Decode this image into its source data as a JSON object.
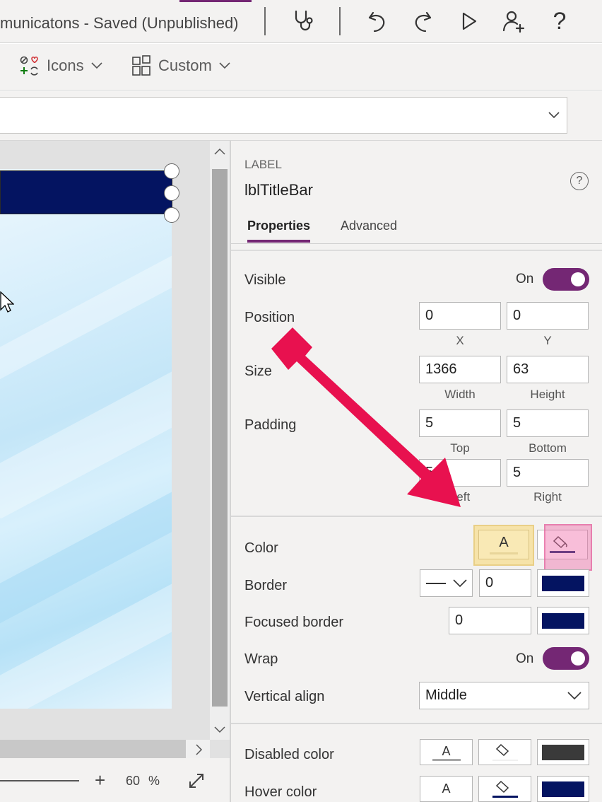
{
  "titlebar": {
    "title": "municatons - Saved (Unpublished)",
    "icons": [
      "stethoscope-icon",
      "undo-icon",
      "redo-icon",
      "play-icon",
      "add-user-icon",
      "help-icon"
    ]
  },
  "ribbon": {
    "icons_label": "Icons",
    "custom_label": "Custom"
  },
  "canvas": {
    "zoom_value": "60",
    "zoom_unit": "%"
  },
  "panel": {
    "control_type": "LABEL",
    "control_name": "lblTitleBar",
    "tabs": [
      {
        "label": "Properties",
        "active": true
      },
      {
        "label": "Advanced",
        "active": false
      }
    ],
    "visible": {
      "label": "Visible",
      "state": "On"
    },
    "position": {
      "label": "Position",
      "x": "0",
      "y": "0",
      "x_caption": "X",
      "y_caption": "Y"
    },
    "size": {
      "label": "Size",
      "width": "1366",
      "height": "63",
      "width_caption": "Width",
      "height_caption": "Height"
    },
    "padding": {
      "label": "Padding",
      "top": "5",
      "bottom": "5",
      "left": "5",
      "right": "5",
      "top_caption": "Top",
      "bottom_caption": "Bottom",
      "left_caption": "Left",
      "right_caption": "Right"
    },
    "color": {
      "label": "Color",
      "text_glyph": "A"
    },
    "border": {
      "label": "Border",
      "value": "0",
      "swatch": "#041461"
    },
    "focused_border": {
      "label": "Focused border",
      "value": "0",
      "swatch": "#041461"
    },
    "wrap": {
      "label": "Wrap",
      "state": "On"
    },
    "vertical_align": {
      "label": "Vertical align",
      "value": "Middle"
    },
    "disabled_color": {
      "label": "Disabled color",
      "text_glyph": "A",
      "swatch": "#3a3a3a"
    },
    "hover_color": {
      "label": "Hover color",
      "text_glyph": "A",
      "swatch": "#041461"
    }
  },
  "colors": {
    "accent": "#742774",
    "title_bar_fill": "#041461",
    "highlight_yellow": "#f6e3a9",
    "highlight_pink": "#f4b3cc",
    "arrow": "#e8114f"
  }
}
